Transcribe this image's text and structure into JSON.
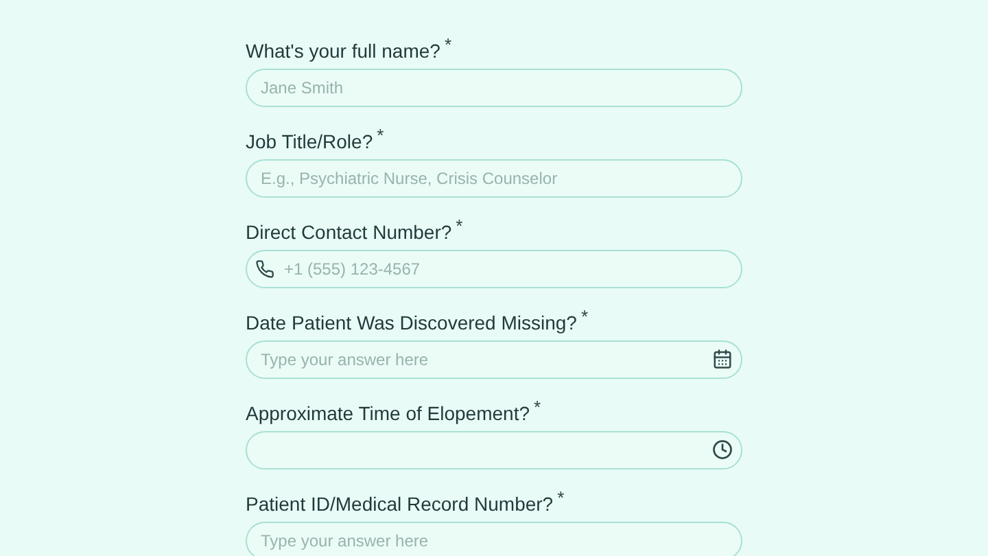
{
  "questions": [
    {
      "label": "What's your full name?",
      "required_mark": "*",
      "kind": "text",
      "placeholder": "Jane Smith"
    },
    {
      "label": "Job Title/Role?",
      "required_mark": "*",
      "kind": "text",
      "placeholder": "E.g., Psychiatric Nurse, Crisis Counselor"
    },
    {
      "label": "Direct Contact Number?",
      "required_mark": "*",
      "kind": "phone",
      "placeholder": "+1 (555) 123-4567"
    },
    {
      "label": "Date Patient Was Discovered Missing?",
      "required_mark": "*",
      "kind": "date",
      "placeholder": "Type your answer here"
    },
    {
      "label": "Approximate Time of Elopement?",
      "required_mark": "*",
      "kind": "time"
    },
    {
      "label": "Patient ID/Medical Record Number?",
      "required_mark": "*",
      "kind": "text",
      "placeholder": "Type your answer here"
    }
  ]
}
